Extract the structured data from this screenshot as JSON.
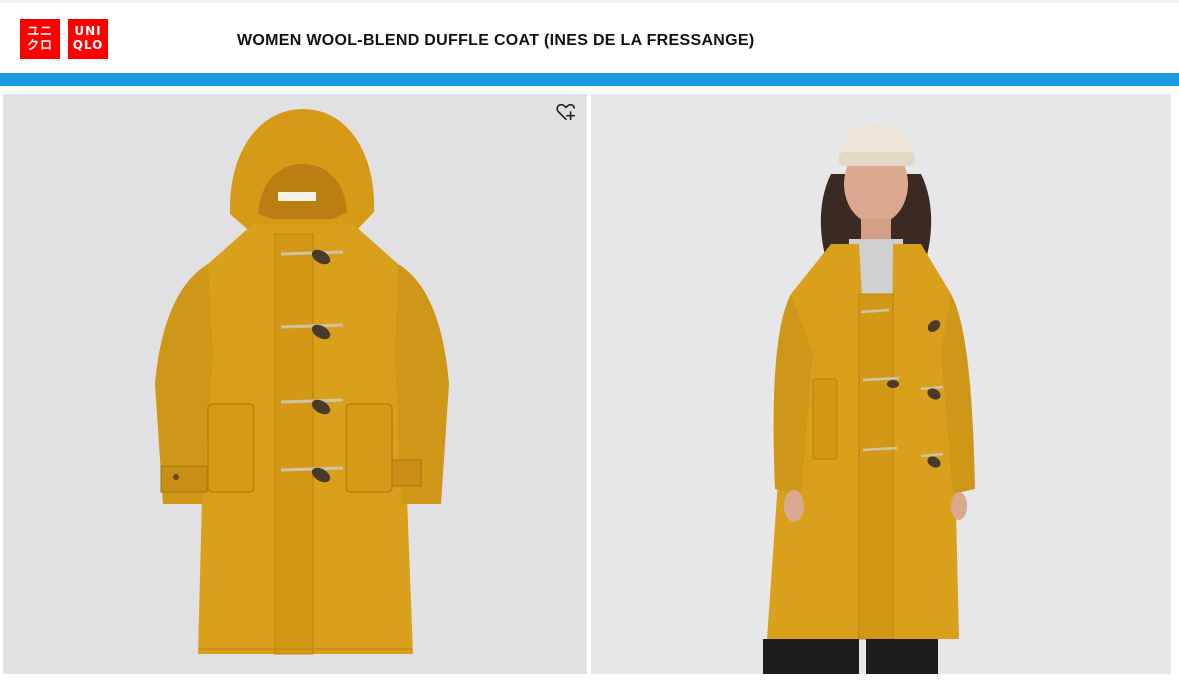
{
  "brand": {
    "logo_left": [
      "ユニ",
      "クロ"
    ],
    "logo_right": [
      "UNI",
      "QLO"
    ],
    "color": "#ff0000"
  },
  "product": {
    "title": "WOMEN WOOL-BLEND DUFFLE COAT (INES DE LA FRESSANGE)"
  },
  "colors": {
    "accent_bar": "#1a9ae0",
    "coat": "#d9a01c"
  },
  "icons": {
    "wishlist": "heart-plus-icon"
  },
  "images": [
    {
      "name": "product-flat-image",
      "description": "coat"
    },
    {
      "name": "model-image",
      "description": "model"
    }
  ]
}
